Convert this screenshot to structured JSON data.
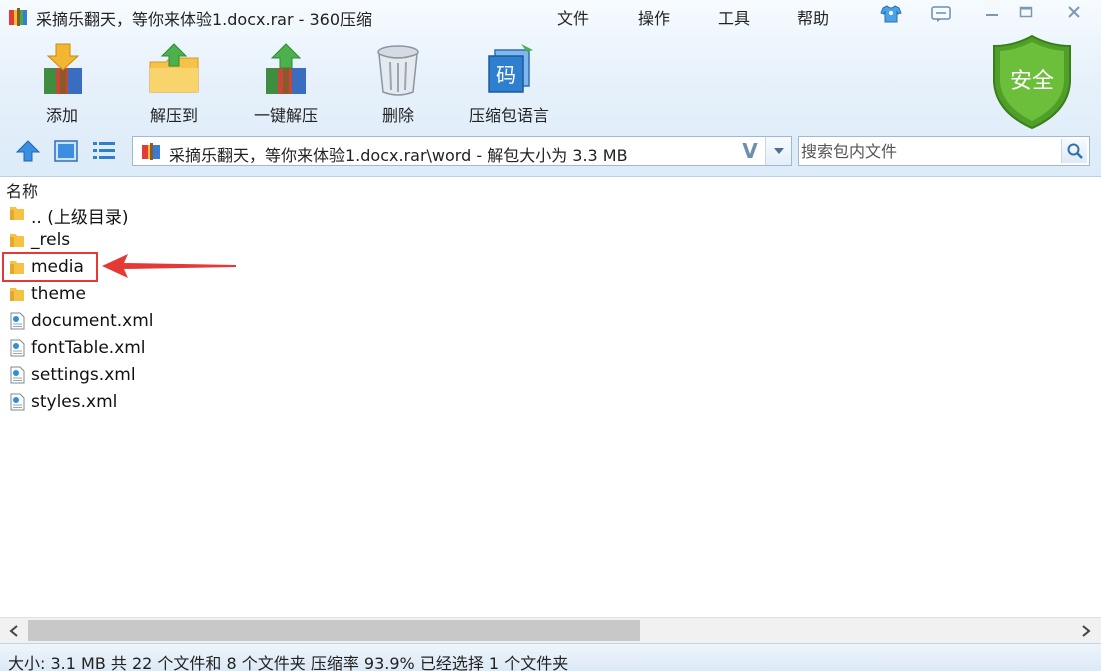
{
  "window": {
    "title": "采摘乐翻天，等你来体验1.docx.rar - 360压缩"
  },
  "menu": {
    "items": [
      "文件",
      "操作",
      "工具",
      "帮助"
    ]
  },
  "toolbar": {
    "add": "添加",
    "extract_to": "解压到",
    "one_click_extract": "一键解压",
    "delete": "删除",
    "archive_language": "压缩包语言",
    "language_icon_glyph": "码",
    "shield_text": "安全"
  },
  "address": {
    "path": "采摘乐翻天，等你来体验1.docx.rar\\word - 解包大小为 3.3 MB",
    "v_glyph": "V"
  },
  "search": {
    "placeholder": "搜索包内文件"
  },
  "list": {
    "column_name": "名称",
    "items": [
      {
        "name": ".. (上级目录)",
        "type": "folder"
      },
      {
        "name": "_rels",
        "type": "folder"
      },
      {
        "name": "media",
        "type": "folder"
      },
      {
        "name": "theme",
        "type": "folder"
      },
      {
        "name": "document.xml",
        "type": "xml"
      },
      {
        "name": "fontTable.xml",
        "type": "xml"
      },
      {
        "name": "settings.xml",
        "type": "xml"
      },
      {
        "name": "styles.xml",
        "type": "xml"
      }
    ],
    "highlighted_item": "media"
  },
  "status": {
    "text": "大小: 3.1 MB 共 22 个文件和 8 个文件夹 压缩率 93.9% 已经选择 1 个文件夹"
  },
  "colors": {
    "folder": "#f5c244",
    "highlight": "#e53935",
    "accent": "#2f7fd0",
    "shield": "#5cae2e"
  }
}
